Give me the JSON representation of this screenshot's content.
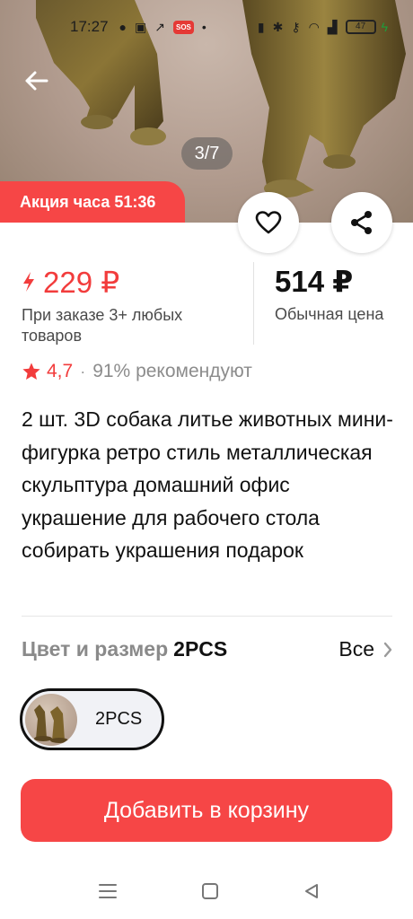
{
  "status_bar": {
    "time": "17:27",
    "battery": "47",
    "sos": "SOS"
  },
  "gallery": {
    "counter": "3/7"
  },
  "promo": {
    "label": "Акция часа 51:36"
  },
  "price": {
    "promo_price": "229 ₽",
    "promo_note": "При заказе 3+ любых товаров",
    "regular_price": "514 ₽",
    "regular_note": "Обычная цена"
  },
  "rating": {
    "value": "4,7",
    "separator": "·",
    "recommend": "91% рекомендуют"
  },
  "product": {
    "title": "2 шт. 3D собака литье животных мини-фигурка ретро стиль металлическая скульптура домашний офис украшение для рабочего стола собирать украшения подарок"
  },
  "variant": {
    "label": "Цвет и размер",
    "selected": "2PCS",
    "all_label": "Все",
    "options": [
      "2PCS"
    ]
  },
  "actions": {
    "add_to_cart": "Добавить в корзину"
  },
  "colors": {
    "accent": "#f64646",
    "price_red": "#f23c3c",
    "chip_bg": "#f1f2f6"
  },
  "icons": {
    "back": "arrow-left-icon",
    "favorite": "heart-icon",
    "share": "share-icon",
    "star": "star-icon",
    "bolt": "lightning-icon",
    "chevron": "chevron-right-icon"
  }
}
